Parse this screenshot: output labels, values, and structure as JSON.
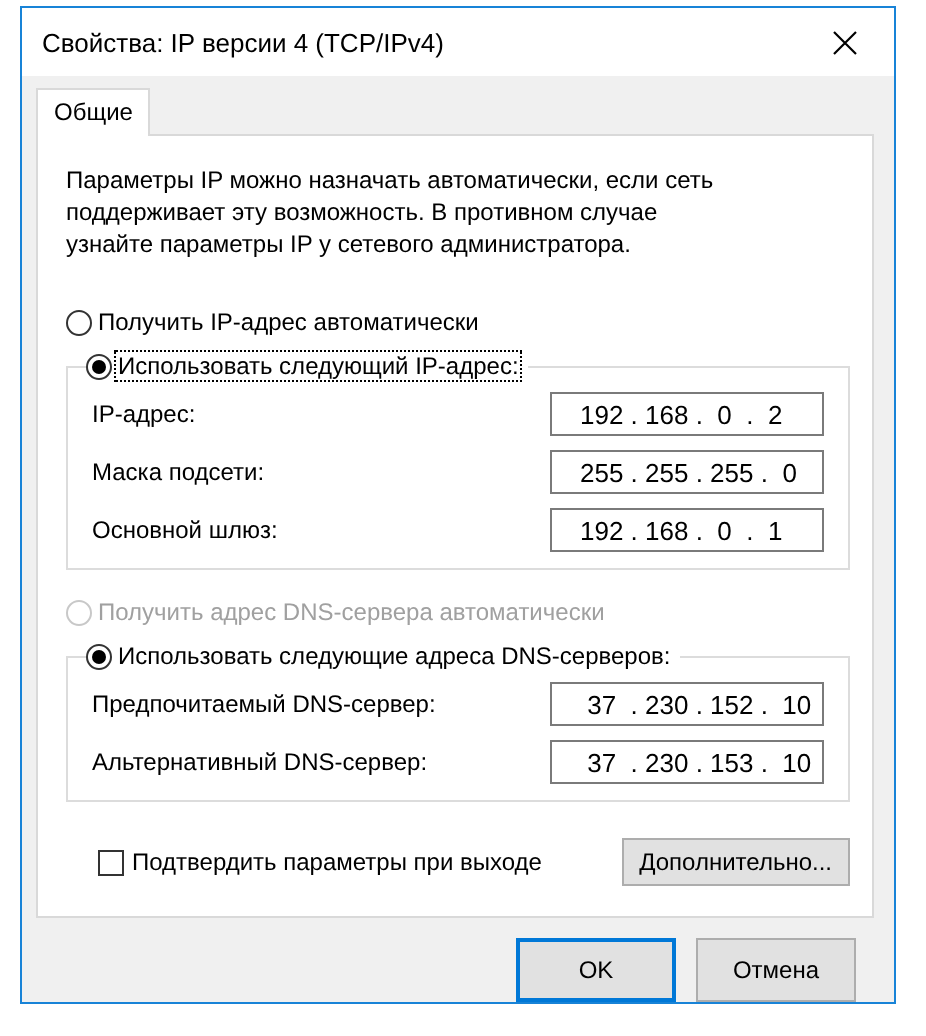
{
  "window": {
    "title": "Свойства: IP версии 4 (TCP/IPv4)"
  },
  "tabs": [
    {
      "label": "Общие",
      "selected": true
    }
  ],
  "description": "Параметры IP можно назначать автоматически, если сеть поддерживает эту возможность. В противном случае узнайте параметры IP у сетевого администратора.",
  "ip_section": {
    "auto_option": {
      "label": "Получить IP-адрес автоматически",
      "selected": false,
      "disabled": false
    },
    "manual_option": {
      "label": "Использовать следующий IP-адрес:",
      "selected": true,
      "disabled": false
    },
    "fields": [
      {
        "label": "IP-адрес:",
        "value": "192 . 168 .  0  .  2"
      },
      {
        "label": "Маска подсети:",
        "value": "255 . 255 . 255 .  0"
      },
      {
        "label": "Основной шлюз:",
        "value": "192 . 168 .  0  .  1"
      }
    ]
  },
  "dns_section": {
    "auto_option": {
      "label": "Получить адрес DNS-сервера автоматически",
      "selected": false,
      "disabled": true
    },
    "manual_option": {
      "label": "Использовать следующие адреса DNS-серверов:",
      "selected": true,
      "disabled": false
    },
    "fields": [
      {
        "label": "Предпочитаемый DNS-сервер:",
        "value": " 37  . 230 . 152 .  10"
      },
      {
        "label": "Альтернативный DNS-сервер:",
        "value": " 37  . 230 . 153 .  10"
      }
    ]
  },
  "validate_on_exit": {
    "label": "Подтвердить параметры при выходе",
    "checked": false
  },
  "advanced_button": "Дополнительно...",
  "buttons": [
    {
      "label": "OK",
      "default": true
    },
    {
      "label": "Отмена",
      "default": false
    }
  ]
}
